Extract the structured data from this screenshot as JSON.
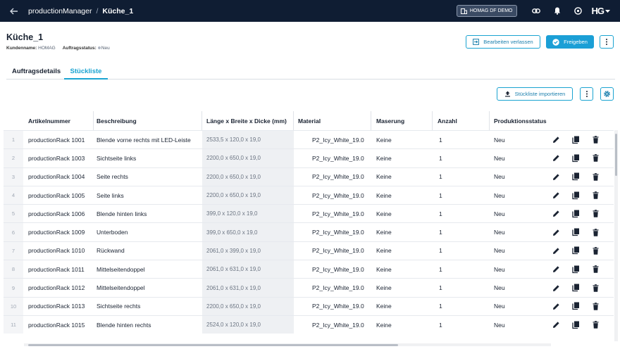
{
  "topbar": {
    "app": "productionManager",
    "separator": "/",
    "current": "Küche_1",
    "demo_label": "HOMAG DF DEMO",
    "logo": "HG"
  },
  "page": {
    "title": "Küche_1",
    "customer_label": "Kundenname:",
    "customer_value": "HOMAG",
    "status_label": "Auftragsstatus:",
    "status_value": "Neu",
    "leave_edit": "Bearbeiten verlassen",
    "release": "Freigeben"
  },
  "tabs": [
    "Auftragsdetails",
    "Stückliste"
  ],
  "toolbar": {
    "import_label": "Stückliste importieren"
  },
  "table": {
    "headers": [
      "Artikelnummer",
      "Beschreibung",
      "Länge x Breite x Dicke (mm)",
      "Material",
      "Maserung",
      "Anzahl",
      "Produktionsstatus"
    ],
    "rows": [
      {
        "n": "1",
        "art": "productionRack 1001",
        "desc": "Blende vorne rechts mit LED-Leiste",
        "dim": "2533,5 x 120,0 x 19,0",
        "mat": "P2_Icy_White_19.0",
        "mas": "Keine",
        "qty": "1",
        "status": "Neu"
      },
      {
        "n": "2",
        "art": "productionRack 1003",
        "desc": "Sichtseite links",
        "dim": "2200,0 x 650,0 x 19,0",
        "mat": "P2_Icy_White_19.0",
        "mas": "Keine",
        "qty": "1",
        "status": "Neu"
      },
      {
        "n": "3",
        "art": "productionRack 1004",
        "desc": "Seite rechts",
        "dim": "2200,0 x 650,0 x 19,0",
        "mat": "P2_Icy_White_19.0",
        "mas": "Keine",
        "qty": "1",
        "status": "Neu"
      },
      {
        "n": "4",
        "art": "productionRack 1005",
        "desc": "Seite links",
        "dim": "2200,0 x 650,0 x 19,0",
        "mat": "P2_Icy_White_19.0",
        "mas": "Keine",
        "qty": "1",
        "status": "Neu"
      },
      {
        "n": "5",
        "art": "productionRack 1006",
        "desc": "Blende hinten links",
        "dim": "399,0 x 120,0 x 19,0",
        "mat": "P2_Icy_White_19.0",
        "mas": "Keine",
        "qty": "1",
        "status": "Neu"
      },
      {
        "n": "6",
        "art": "productionRack 1009",
        "desc": "Unterboden",
        "dim": "399,0 x 650,0 x 19,0",
        "mat": "P2_Icy_White_19.0",
        "mas": "Keine",
        "qty": "1",
        "status": "Neu"
      },
      {
        "n": "7",
        "art": "productionRack 1010",
        "desc": "Rückwand",
        "dim": "2061,0 x 399,0 x 19,0",
        "mat": "P2_Icy_White_19.0",
        "mas": "Keine",
        "qty": "1",
        "status": "Neu"
      },
      {
        "n": "8",
        "art": "productionRack 1011",
        "desc": "Mittelseitendoppel",
        "dim": "2061,0 x 631,0 x 19,0",
        "mat": "P2_Icy_White_19.0",
        "mas": "Keine",
        "qty": "1",
        "status": "Neu"
      },
      {
        "n": "9",
        "art": "productionRack 1012",
        "desc": "Mittelseitendoppel",
        "dim": "2061,0 x 631,0 x 19,0",
        "mat": "P2_Icy_White_19.0",
        "mas": "Keine",
        "qty": "1",
        "status": "Neu"
      },
      {
        "n": "10",
        "art": "productionRack 1013",
        "desc": "Sichtseite rechts",
        "dim": "2200,0 x 650,0 x 19,0",
        "mat": "P2_Icy_White_19.0",
        "mas": "Keine",
        "qty": "1",
        "status": "Neu"
      },
      {
        "n": "11",
        "art": "productionRack 1015",
        "desc": "Blende hinten rechts",
        "dim": "2524,0 x 120,0 x 19,0",
        "mat": "P2_Icy_White_19.0",
        "mas": "Keine",
        "qty": "1",
        "status": "Neu"
      }
    ]
  },
  "colors": {
    "topbar": "#0f1d33",
    "accent": "#1b9fd6"
  },
  "icons": [
    "back-arrow-icon",
    "building-icon",
    "link-icon",
    "bell-icon",
    "support-icon",
    "chevron-down-icon",
    "exit-icon",
    "check-circle-icon",
    "more-vert-icon",
    "upload-icon",
    "gear-icon",
    "pencil-icon",
    "copy-icon",
    "trash-icon"
  ]
}
